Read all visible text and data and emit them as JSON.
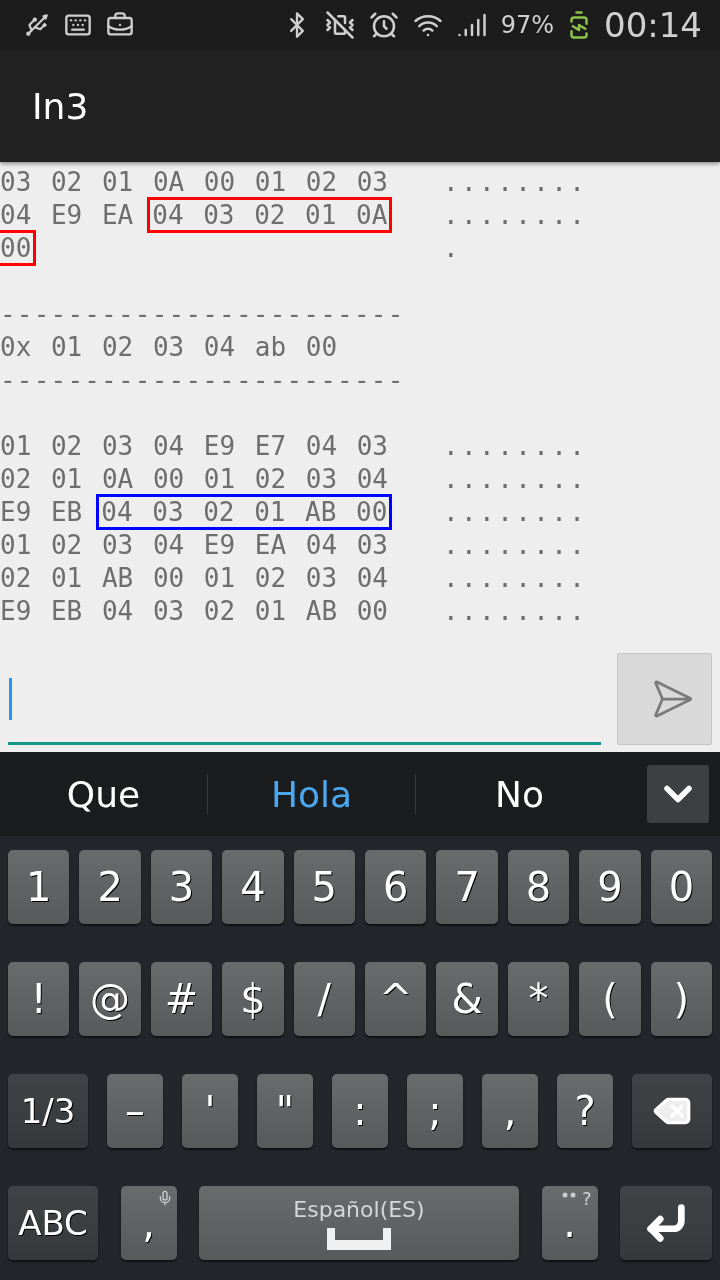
{
  "status_bar": {
    "battery": "97%",
    "time": "00:14"
  },
  "app_bar": {
    "title": "In3"
  },
  "dump": [
    {
      "kind": "hex",
      "segments": [
        {
          "text": "03 02 01 0A 00 01 02 03"
        }
      ],
      "ascii": "........"
    },
    {
      "kind": "hex",
      "segments": [
        {
          "text": "04 E9 EA"
        },
        {
          "text": "04 03 02 01 0A",
          "color": "#ff0000"
        }
      ],
      "ascii": "........"
    },
    {
      "kind": "hex",
      "segments": [
        {
          "text": "00",
          "color": "#ff0000"
        }
      ],
      "ascii": "."
    },
    {
      "kind": "blank"
    },
    {
      "kind": "separator",
      "text": "------------------------"
    },
    {
      "kind": "text",
      "text": "0x 01 02 03 04 ab 00"
    },
    {
      "kind": "separator",
      "text": "------------------------"
    },
    {
      "kind": "blank"
    },
    {
      "kind": "hex",
      "segments": [
        {
          "text": "01 02 03 04 E9 E7 04 03"
        }
      ],
      "ascii": "........"
    },
    {
      "kind": "hex",
      "segments": [
        {
          "text": "02 01 0A 00 01 02 03 04"
        }
      ],
      "ascii": "........"
    },
    {
      "kind": "hex",
      "segments": [
        {
          "text": "E9 EB"
        },
        {
          "text": "04 03 02 01 AB 00",
          "color": "#0000ff"
        }
      ],
      "ascii": "........"
    },
    {
      "kind": "hex",
      "segments": [
        {
          "text": "01 02 03 04 E9 EA 04 03"
        }
      ],
      "ascii": "........"
    },
    {
      "kind": "hex",
      "segments": [
        {
          "text": "02 01 AB 00 01 02 03 04"
        }
      ],
      "ascii": "........"
    },
    {
      "kind": "hex",
      "segments": [
        {
          "text": "E9 EB 04 03 02 01 AB 00"
        }
      ],
      "ascii": "........"
    }
  ],
  "suggestions": [
    {
      "text": "Que",
      "selected": false
    },
    {
      "text": "Hola",
      "selected": true
    },
    {
      "text": "No",
      "selected": false
    }
  ],
  "keyboard": {
    "digit_row": [
      {
        "kind": "char",
        "label": "1"
      },
      {
        "kind": "char",
        "label": "2"
      },
      {
        "kind": "char",
        "label": "3"
      },
      {
        "kind": "char",
        "label": "4"
      },
      {
        "kind": "char",
        "label": "5"
      },
      {
        "kind": "char",
        "label": "6"
      },
      {
        "kind": "char",
        "label": "7"
      },
      {
        "kind": "char",
        "label": "8"
      },
      {
        "kind": "char",
        "label": "9"
      },
      {
        "kind": "char",
        "label": "0"
      }
    ],
    "symbol_row": [
      {
        "kind": "char",
        "label": "!"
      },
      {
        "kind": "char",
        "label": "@"
      },
      {
        "kind": "char",
        "label": "#"
      },
      {
        "kind": "char",
        "label": "$"
      },
      {
        "kind": "char",
        "label": "/"
      },
      {
        "kind": "char",
        "label": "^"
      },
      {
        "kind": "char",
        "label": "&"
      },
      {
        "kind": "char",
        "label": "*"
      },
      {
        "kind": "char",
        "label": "("
      },
      {
        "kind": "char",
        "label": ")"
      }
    ],
    "punctuation_row": [
      {
        "kind": "mode",
        "label": "1/3"
      },
      {
        "kind": "char",
        "label": "–"
      },
      {
        "kind": "char",
        "label": "'"
      },
      {
        "kind": "char",
        "label": "\""
      },
      {
        "kind": "char",
        "label": ":"
      },
      {
        "kind": "char",
        "label": ";"
      },
      {
        "kind": "char",
        "label": ","
      },
      {
        "kind": "char",
        "label": "?"
      },
      {
        "kind": "backspace"
      }
    ],
    "bottom_row": [
      {
        "kind": "mode",
        "label": "ABC"
      },
      {
        "kind": "mic",
        "label": ","
      },
      {
        "kind": "space",
        "label": "Español(ES)"
      },
      {
        "kind": "char",
        "label": ".",
        "hint": "?"
      },
      {
        "kind": "enter"
      }
    ]
  }
}
